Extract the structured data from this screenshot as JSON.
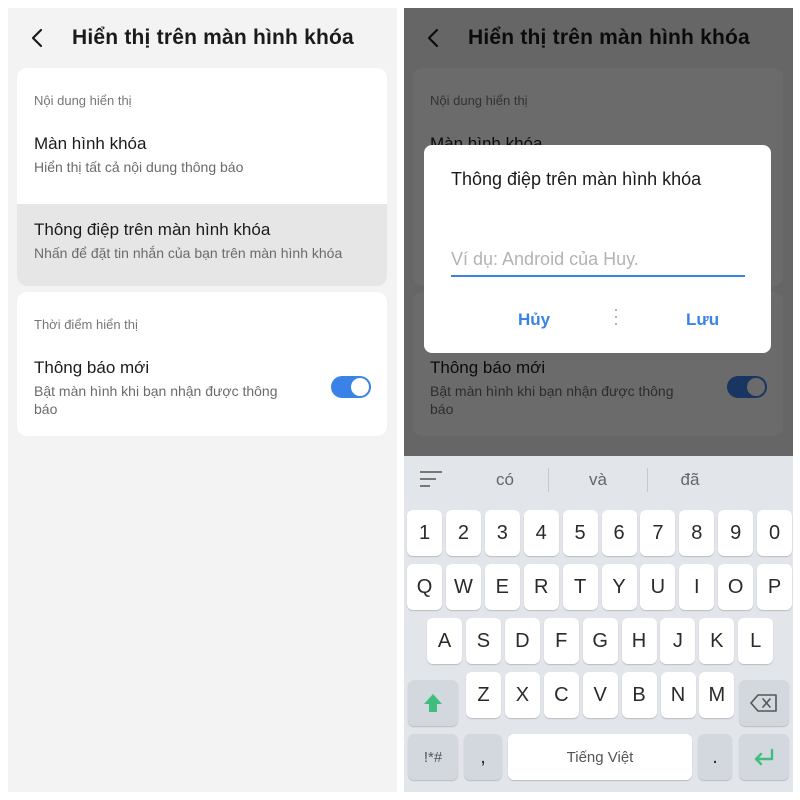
{
  "screen": {
    "title": "Hiển thị trên màn hình khóa",
    "section1_label": "Nội dung hiển thị",
    "item1_title": "Màn hình khóa",
    "item1_sub": "Hiển thị tất cả nội dung thông báo",
    "item2_title": "Thông điệp trên màn hình khóa",
    "item2_sub": "Nhấn để đặt tin nhắn của bạn trên màn hình khóa",
    "section2_label": "Thời điểm hiển thị",
    "item3_title": "Thông báo mới",
    "item3_sub": "Bật màn hình khi bạn nhận được thông báo",
    "toggle_on": true
  },
  "dialog": {
    "title": "Thông điệp trên màn hình khóa",
    "placeholder": "Ví dụ: Android của Huy.",
    "cancel": "Hủy",
    "save": "Lưu"
  },
  "keyboard": {
    "suggestions": [
      "có",
      "và",
      "đã"
    ],
    "row_numbers": [
      "1",
      "2",
      "3",
      "4",
      "5",
      "6",
      "7",
      "8",
      "9",
      "0"
    ],
    "row1": [
      "Q",
      "W",
      "E",
      "R",
      "T",
      "Y",
      "U",
      "I",
      "O",
      "P"
    ],
    "row2": [
      "A",
      "S",
      "D",
      "F",
      "G",
      "H",
      "J",
      "K",
      "L"
    ],
    "row3": [
      "Z",
      "X",
      "C",
      "V",
      "B",
      "N",
      "M"
    ],
    "symbols": "!*#",
    "comma": ",",
    "space_label": "Tiếng Việt",
    "period": "."
  },
  "colors": {
    "accent": "#3b82e8",
    "enter_green": "#3fbf7f",
    "background": "#f3f3f3"
  },
  "icons": {
    "back": "chevron-left-icon",
    "shift": "shift-arrow-icon",
    "delete": "backspace-icon",
    "enter": "enter-return-icon",
    "menu": "menu-lines-icon"
  }
}
